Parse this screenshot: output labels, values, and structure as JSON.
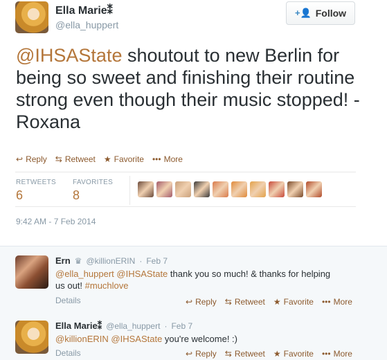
{
  "colors": {
    "link": "#b4763a",
    "actions": "#8c5a2e",
    "muted": "#8899a6",
    "text": "#292f33"
  },
  "tweet": {
    "display_name": "Ella Marie⁑",
    "handle": "@ella_huppert",
    "follow_label": "Follow",
    "mention": "@IHSAState",
    "text_after_mention": " shoutout to new Berlin for being so sweet and finishing their routine strong even though their music stopped! - Roxana",
    "actions": {
      "reply": "Reply",
      "retweet": "Retweet",
      "favorite": "Favorite",
      "more": "More"
    },
    "stats": {
      "retweets_label": "RETWEETS",
      "retweets": "6",
      "favorites_label": "FAVORITES",
      "favorites": "8"
    },
    "timestamp": "9:42 AM - 7 Feb 2014"
  },
  "favoriters": [
    {
      "icon": "avatar-1",
      "color": "#6b4a3a"
    },
    {
      "icon": "avatar-2",
      "color": "#a35a6a"
    },
    {
      "icon": "avatar-3",
      "color": "#c9a07a"
    },
    {
      "icon": "avatar-4",
      "color": "#3a3a3a"
    },
    {
      "icon": "avatar-5",
      "color": "#d97a4a"
    },
    {
      "icon": "avatar-6",
      "color": "#e08a3a"
    },
    {
      "icon": "avatar-7",
      "color": "#e3a24a"
    },
    {
      "icon": "avatar-8",
      "color": "#c84a3a"
    },
    {
      "icon": "avatar-9",
      "color": "#7a4a2a"
    },
    {
      "icon": "avatar-10",
      "color": "#b04a2a"
    }
  ],
  "replies": [
    {
      "name": "Ern",
      "badge": "♛",
      "handle": "@killionERIN",
      "date": "Feb 7",
      "m1": "@ella_huppert",
      "m2": "@IHSAState",
      "text_mid": " thank you so much! & thanks for helping us out! ",
      "hashtag": "#muchlove",
      "details": "Details",
      "actions": {
        "reply": "Reply",
        "retweet": "Retweet",
        "favorite": "Favorite",
        "more": "More"
      }
    },
    {
      "name": "Ella Marie⁑",
      "handle": "@ella_huppert",
      "date": "Feb 7",
      "m1": "@killionERIN",
      "m2": "@IHSAState",
      "text_end": " you're welcome! :)",
      "details": "Details",
      "actions": {
        "reply": "Reply",
        "retweet": "Retweet",
        "favorite": "Favorite",
        "more": "More"
      }
    }
  ]
}
